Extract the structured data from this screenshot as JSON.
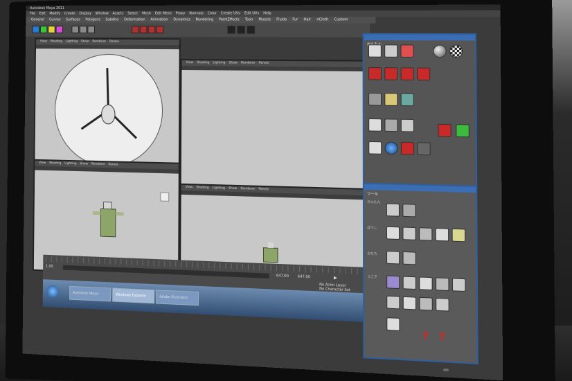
{
  "app": {
    "title_bar": "Autodesk Maya 2011",
    "menus": [
      "File",
      "Edit",
      "Modify",
      "Create",
      "Display",
      "Window",
      "Assets",
      "Select",
      "Mesh",
      "Edit Mesh",
      "Proxy",
      "Normals",
      "Color",
      "Create UVs",
      "Edit UVs",
      "Help"
    ],
    "shelf_tabs": [
      "General",
      "Curves",
      "Surfaces",
      "Polygons",
      "Subdivs",
      "Deformation",
      "Animation",
      "Dynamics",
      "Rendering",
      "PaintEffects",
      "Toon",
      "Muscle",
      "Fluids",
      "Fur",
      "Hair",
      "nCloth",
      "Custom"
    ],
    "viewport_menus": [
      "View",
      "Shading",
      "Lighting",
      "Show",
      "Renderer",
      "Panels"
    ]
  },
  "timeline": {
    "start": "1.00",
    "end_a": "647.00",
    "end_b": "647.00",
    "anim_layer": "No Anim Layer",
    "character_set": "No Character Set"
  },
  "taskbar": {
    "items": [
      "Autodesk Maya",
      "Windows Explorer",
      "Adobe Illustrator"
    ]
  },
  "panels": {
    "upper_title": "かんたん",
    "lower_title": "ツール",
    "lower_sections": [
      "かんたん",
      "ぼうし",
      "かたち",
      "うごき"
    ],
    "help_glyph": "?"
  },
  "colors": {
    "panel_title": "#3a6db3",
    "viewport_bg": "#c8c8c8",
    "accent_red": "#c82a2a",
    "accent_green": "#3dbb3d"
  }
}
